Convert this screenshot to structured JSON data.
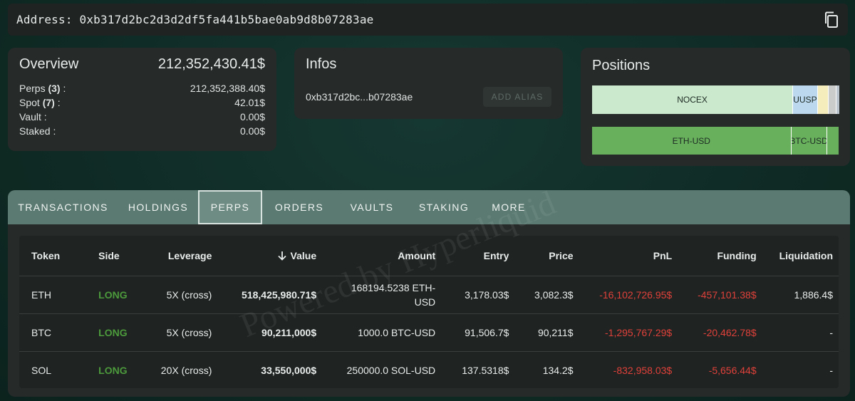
{
  "address": {
    "label": "Address:",
    "value": "0xb317d2bc2d3d2df5fa441b5bae0ab9d8b07283ae"
  },
  "overview": {
    "title": "Overview",
    "total": "212,352,430.41$",
    "rows": [
      {
        "label": "Perps",
        "count": "(3)",
        "suffix": " :",
        "value": "212,352,388.40$"
      },
      {
        "label": "Spot",
        "count": "(7)",
        "suffix": " :",
        "value": "42.01$"
      },
      {
        "label": "Vault :",
        "count": "",
        "suffix": "",
        "value": "0.00$"
      },
      {
        "label": "Staked :",
        "count": "",
        "suffix": "",
        "value": "0.00$"
      }
    ]
  },
  "infos": {
    "title": "Infos",
    "short_address": "0xb317d2bc...b07283ae",
    "add_alias": "ADD ALIAS"
  },
  "positions": {
    "title": "Positions",
    "bar1": [
      {
        "label": "NOCEX",
        "fraction": 0.81,
        "color": "#cbe9cc"
      },
      {
        "label": "UUSP",
        "fraction": 0.1,
        "color": "#bcd8ee"
      },
      {
        "label": "",
        "fraction": 0.045,
        "color": "#f6edbd"
      },
      {
        "label": "",
        "fraction": 0.03,
        "color": "#c9cccb"
      },
      {
        "label": "",
        "fraction": 0.015,
        "color": "#b9c3cc"
      }
    ],
    "bar2": [
      {
        "label": "ETH-USD",
        "fraction": 0.805,
        "color": "#68b05c"
      },
      {
        "label": "BTC-USD",
        "fraction": 0.145,
        "color": "#68b05c"
      },
      {
        "label": "",
        "fraction": 0.05,
        "color": "#68b05c"
      }
    ]
  },
  "tabs": [
    {
      "label": "TRANSACTIONS",
      "active": false
    },
    {
      "label": "HOLDINGS",
      "active": false
    },
    {
      "label": "PERPS",
      "active": true
    },
    {
      "label": "ORDERS",
      "active": false
    },
    {
      "label": "VAULTS",
      "active": false
    },
    {
      "label": "STAKING",
      "active": false
    },
    {
      "label": "MORE",
      "active": false
    }
  ],
  "table": {
    "headers": [
      "Token",
      "Side",
      "Leverage",
      "Value",
      "Amount",
      "Entry",
      "Price",
      "PnL",
      "Funding",
      "Liquidation"
    ],
    "sort_icon": "arrow-down-icon",
    "rows": [
      {
        "token": "ETH",
        "side": "LONG",
        "leverage": "5X (cross)",
        "value": "518,425,980.71$",
        "amount": "168194.5238 ETH-USD",
        "entry": "3,178.03$",
        "price": "3,082.3$",
        "pnl": "-16,102,726.95$",
        "funding": "-457,101.38$",
        "liquidation": "1,886.4$"
      },
      {
        "token": "BTC",
        "side": "LONG",
        "leverage": "5X (cross)",
        "value": "90,211,000$",
        "amount": "1000.0 BTC-USD",
        "entry": "91,506.7$",
        "price": "90,211$",
        "pnl": "-1,295,767.29$",
        "funding": "-20,462.78$",
        "liquidation": "-"
      },
      {
        "token": "SOL",
        "side": "LONG",
        "leverage": "20X (cross)",
        "value": "33,550,000$",
        "amount": "250000.0 SOL-USD",
        "entry": "137.5318$",
        "price": "134.2$",
        "pnl": "-832,958.03$",
        "funding": "-5,656.44$",
        "liquidation": "-"
      }
    ]
  },
  "watermark": "Powered by Hyperliquid",
  "colors": {
    "long": "#4c9a3c",
    "negative": "#e0413a",
    "tabbar": "#5b7a72"
  }
}
